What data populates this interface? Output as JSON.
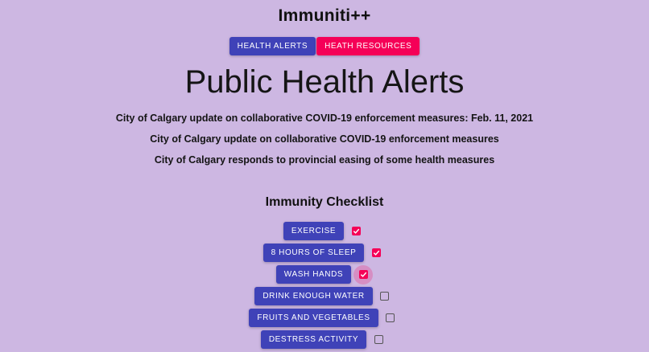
{
  "app": {
    "title": "Immuniti++"
  },
  "nav": {
    "health_alerts_label": "HEALTH ALERTS",
    "health_resources_label": "HEATH RESOURCES"
  },
  "main": {
    "title": "Public Health Alerts",
    "alerts": [
      "City of Calgary update on collaborative COVID-19 enforcement measures: Feb. 11, 2021",
      "City of Calgary update on collaborative COVID-19 enforcement measures",
      "City of Calgary responds to provincial easing of some health measures"
    ]
  },
  "checklist": {
    "title": "Immunity Checklist",
    "items": [
      {
        "label": "EXERCISE",
        "checked": true
      },
      {
        "label": "8 HOURS OF SLEEP",
        "checked": true
      },
      {
        "label": "WASH HANDS",
        "checked": true
      },
      {
        "label": "DRINK ENOUGH WATER",
        "checked": false
      },
      {
        "label": "FRUITS AND VEGETABLES",
        "checked": false
      },
      {
        "label": "DESTRESS ACTIVITY",
        "checked": false
      }
    ]
  },
  "colors": {
    "background": "#cdb7e2",
    "primary": "#3f42b8",
    "secondary": "#f50057"
  },
  "icons": {
    "checked": "checkbox-checked-icon",
    "unchecked": "checkbox-unchecked-icon"
  }
}
